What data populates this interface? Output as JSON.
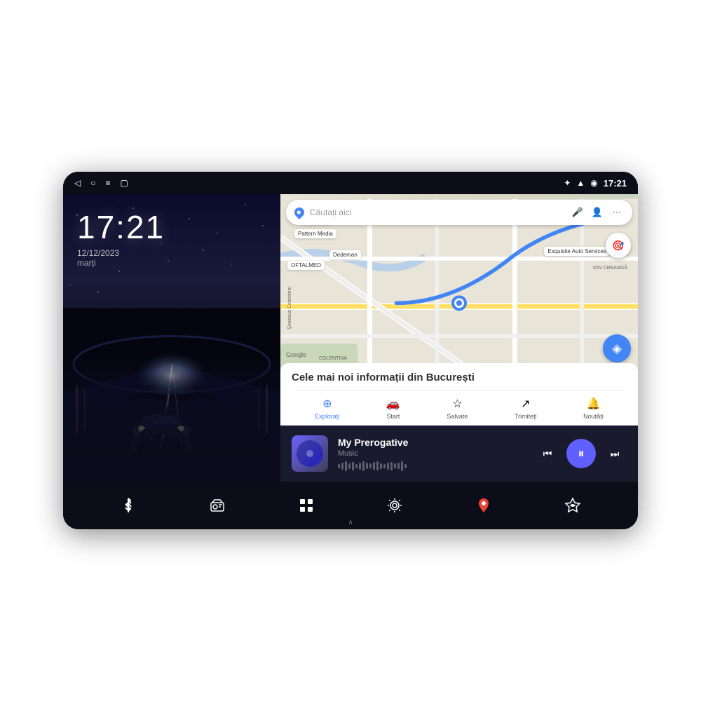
{
  "device": {
    "status_bar": {
      "back_icon": "◁",
      "circle_icon": "○",
      "menu_icon": "≡",
      "square_icon": "▢",
      "bluetooth_icon": "✦",
      "wifi_icon": "▲",
      "time": "17:21"
    },
    "left_panel": {
      "clock_time": "17:21",
      "clock_date": "12/12/2023",
      "clock_day": "marți"
    },
    "right_panel": {
      "map": {
        "search_placeholder": "Căutați aici",
        "info_title": "Cele mai noi informații din București",
        "nav_items": [
          {
            "label": "Explorați",
            "icon": "⊕",
            "active": true
          },
          {
            "label": "Start",
            "icon": "▶",
            "active": false
          },
          {
            "label": "Salvate",
            "icon": "☆",
            "active": false
          },
          {
            "label": "Trimiteți",
            "icon": "↗",
            "active": false
          },
          {
            "label": "Noutăți",
            "icon": "🔔",
            "active": false
          }
        ]
      },
      "music_player": {
        "song_title": "My Prerogative",
        "song_subtitle": "Music",
        "prev_icon": "⏮",
        "play_icon": "⏸",
        "next_icon": "⏭"
      }
    },
    "bottom_dock": {
      "items": [
        {
          "icon": "✦",
          "name": "bluetooth"
        },
        {
          "icon": "📻",
          "name": "radio"
        },
        {
          "icon": "⊞",
          "name": "apps"
        },
        {
          "icon": "⚙",
          "name": "settings"
        },
        {
          "icon": "⊕",
          "name": "maps"
        },
        {
          "icon": "◈",
          "name": "extra"
        }
      ],
      "chevron": "∧"
    }
  }
}
